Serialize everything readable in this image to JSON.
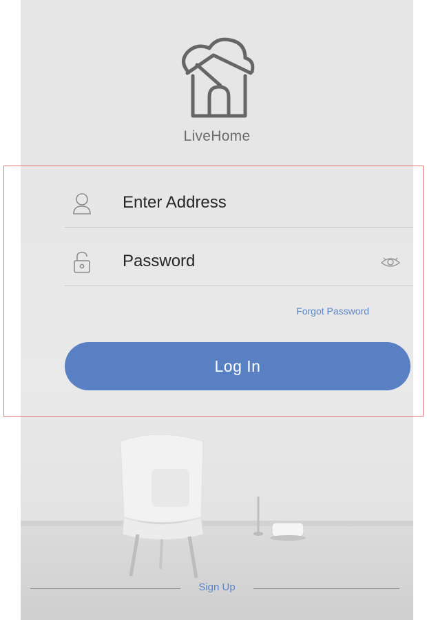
{
  "app": {
    "brand_name": "LiveHome",
    "logo_icon": "house-cloud-icon"
  },
  "login_form": {
    "address_field": {
      "value": "Enter Address",
      "icon": "user-icon"
    },
    "password_field": {
      "value": "Password",
      "icon": "lock-icon",
      "toggle_icon": "eye-icon"
    },
    "forgot_password_label": "Forgot Password",
    "login_button_label": "Log In"
  },
  "footer": {
    "signup_label": "Sign Up"
  },
  "colors": {
    "accent": "#5a80c4",
    "link": "#5b86c7",
    "background": "#e7e7e7",
    "highlight_border": "#e07a7a"
  }
}
